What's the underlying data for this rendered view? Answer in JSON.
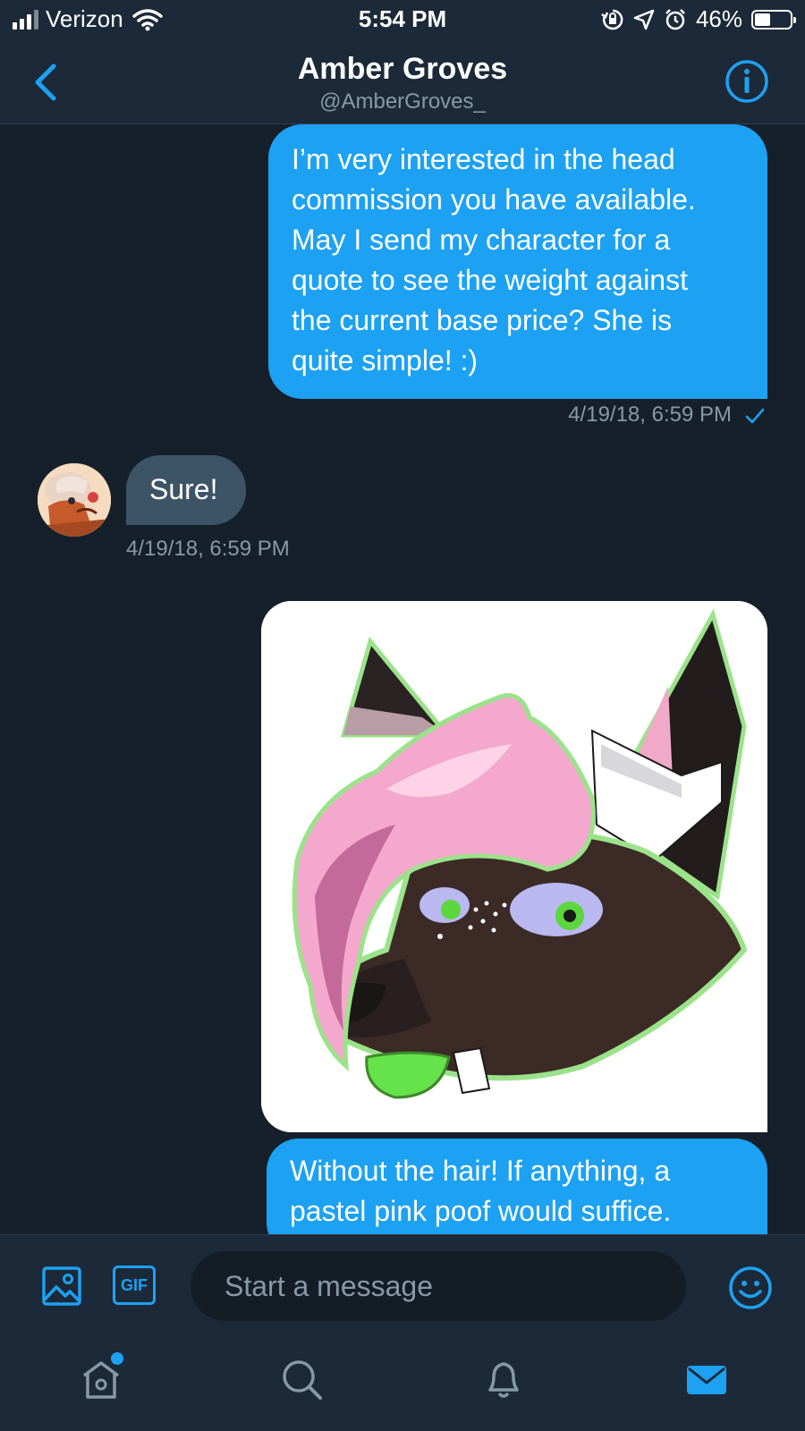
{
  "status_bar": {
    "carrier": "Verizon",
    "time": "5:54 PM",
    "battery": "46%",
    "battery_level": 0.46
  },
  "header": {
    "title": "Amber Groves",
    "handle": "@AmberGroves_"
  },
  "messages": [
    {
      "direction": "outgoing",
      "type": "text",
      "lines": [
        "I’m very interested in the head",
        "commission you have available.",
        "May I send my character for a",
        "quote to see the weight against",
        "the current base price? She is",
        "quite simple! :)"
      ],
      "timestamp": "4/19/18, 6:59 PM",
      "read_icon": "checkmark-icon"
    },
    {
      "direction": "incoming",
      "type": "text",
      "text": "Sure!",
      "timestamp": "4/19/18, 6:59 PM"
    },
    {
      "direction": "outgoing",
      "type": "image",
      "icon": "character-head-image"
    },
    {
      "direction": "outgoing",
      "type": "text",
      "lines": [
        "Without the hair! If anything, a",
        "pastel pink poof would suffice."
      ]
    }
  ],
  "composer": {
    "gif_label": "GIF",
    "placeholder": "Start a message"
  },
  "tab_bar": [
    {
      "icon": "home-icon",
      "has_notification": true
    },
    {
      "icon": "search-icon"
    },
    {
      "icon": "bell-icon"
    },
    {
      "icon": "mail-icon",
      "active": true
    }
  ],
  "colors": {
    "accent": "#1da1f2",
    "background": "#15202b",
    "bar": "#1c2938",
    "incoming_bubble": "#3d5466",
    "secondary_text": "#8899a6"
  }
}
